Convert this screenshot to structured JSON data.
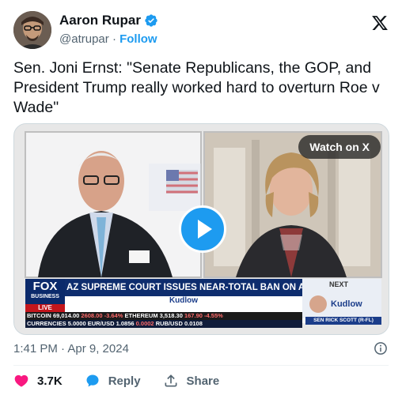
{
  "author": {
    "name": "Aaron Rupar",
    "handle": "@atrupar",
    "separator": "·",
    "follow_label": "Follow"
  },
  "tweet": {
    "text": "Sen. Joni Ernst: \"Senate Republicans, the GOP, and President Trump really worked hard to overturn Roe v Wade\""
  },
  "media": {
    "watch_label": "Watch on X",
    "network_logo": "FOX",
    "network_sub": "BUSINESS",
    "live_label": "LIVE",
    "headline": "AZ SUPREME COURT ISSUES NEAR-TOTAL BAN ON ABORTION",
    "show_name": "Kudlow",
    "next_label": "NEXT",
    "next_show": "Kudlow",
    "next_guest": "SEN RICK SCOTT (R-FL)",
    "ticker_row1": [
      {
        "label": "BITCOIN",
        "value": "69,014.00",
        "change": "2608.00",
        "pct": "-3.64%"
      },
      {
        "label": "ETHEREUM",
        "value": "3,518.30",
        "change": "167.90",
        "pct": "-4.55%"
      }
    ],
    "ticker_row2": [
      {
        "label": "CURRENCIES",
        "value": "5.0000"
      },
      {
        "label": "EUR/USD",
        "value": "1.0856",
        "change": "0.0002"
      },
      {
        "label": "RUB/USD",
        "value": "0.0108"
      }
    ]
  },
  "timestamp": "1:41 PM · Apr 9, 2024",
  "actions": {
    "likes": "3.7K",
    "reply_label": "Reply",
    "share_label": "Share"
  },
  "colors": {
    "accent": "#1d9bf0",
    "like": "#f91880",
    "text": "#0f1419",
    "muted": "#536471"
  }
}
